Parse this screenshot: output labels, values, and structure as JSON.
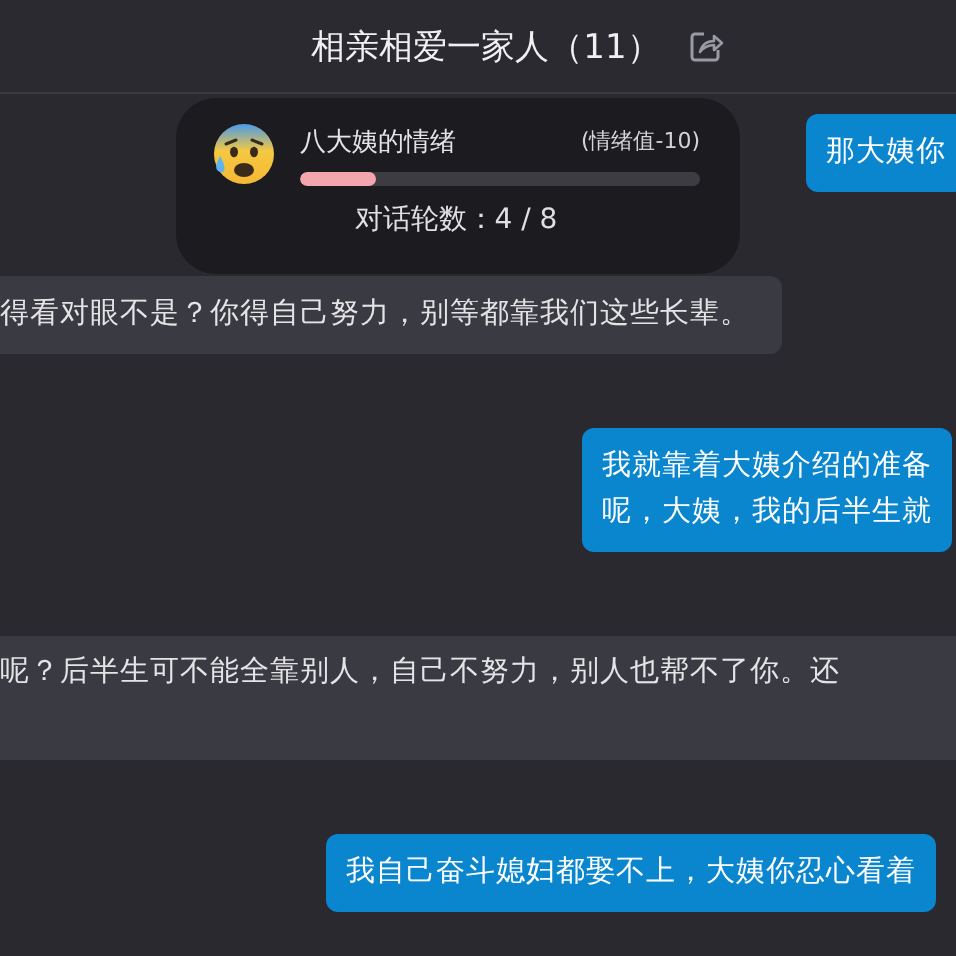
{
  "header": {
    "title": "相亲相爱一家人（11）"
  },
  "mood_card": {
    "label": "八大姨的情绪",
    "value": "(情绪值-10)",
    "level": 0.19,
    "rounds": "对话轮数：4 / 8"
  },
  "messages": [
    {
      "kind": "outgoing",
      "lines": [
        "那大姨你"
      ]
    },
    {
      "kind": "incoming",
      "lines": [
        "得看对眼不是？你得自己努力，别等都靠我们这些长辈。"
      ]
    },
    {
      "kind": "outgoing",
      "lines": [
        "我就靠着大姨介绍的准备",
        "呢，大姨，我的后半生就"
      ]
    },
    {
      "kind": "incoming",
      "lines": [
        "呢？后半生可不能全靠别人，自己不努力，别人也帮不了你。还"
      ]
    },
    {
      "kind": "outgoing",
      "lines": [
        "我自己奋斗媳妇都娶不上，大姨你忍心看着"
      ]
    }
  ]
}
